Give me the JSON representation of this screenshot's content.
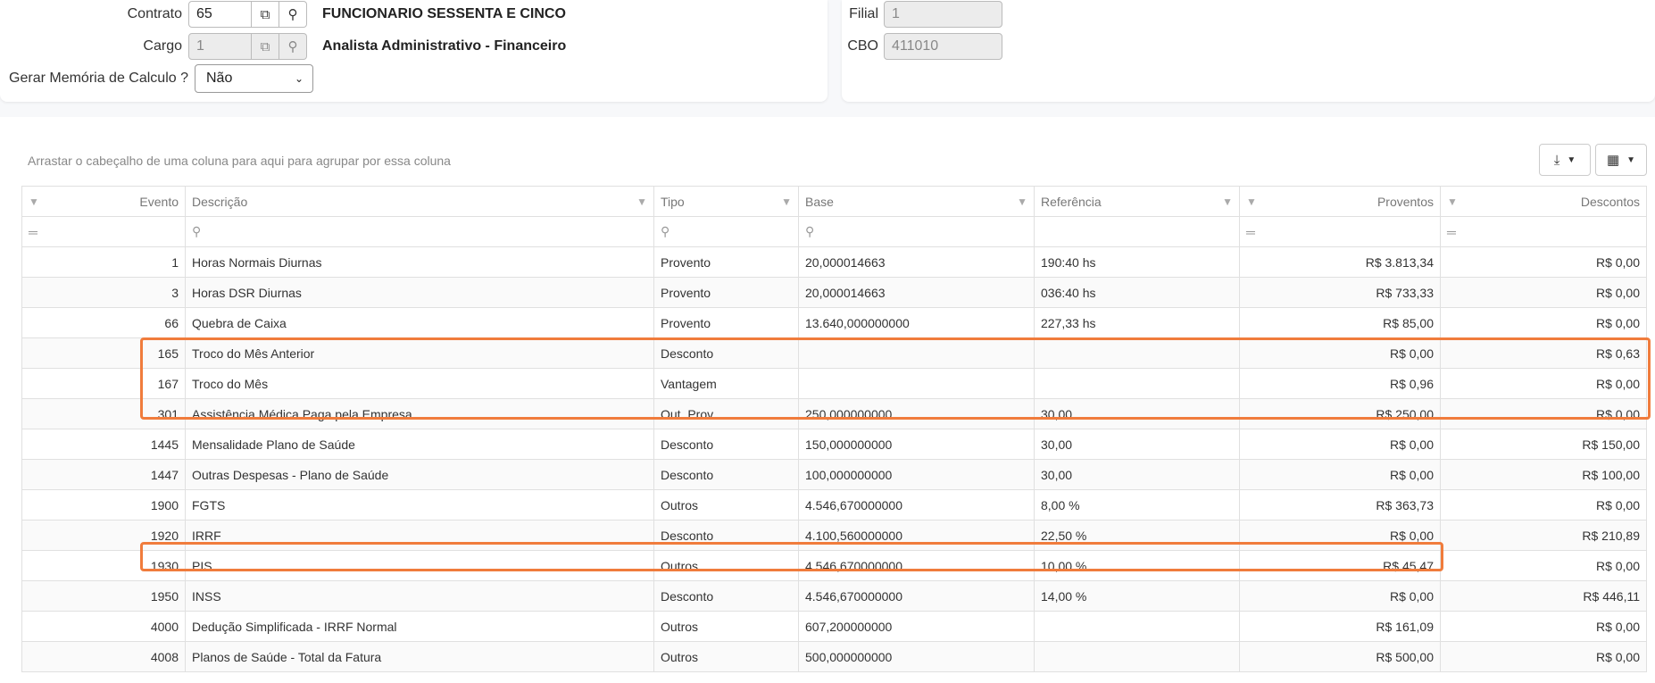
{
  "form": {
    "contrato_label": "Contrato",
    "contrato_value": "65",
    "contrato_name": "FUNCIONARIO SESSENTA E CINCO",
    "cargo_label": "Cargo",
    "cargo_value": "1",
    "cargo_name": "Analista Administrativo - Financeiro",
    "memoria_label": "Gerar Memória de Calculo ?",
    "memoria_value": "Não",
    "filial_label": "Filial",
    "filial_value": "1",
    "cbo_label": "CBO",
    "cbo_value": "411010"
  },
  "grid": {
    "group_hint": "Arrastar o cabeçalho de uma coluna para aqui para agrupar por essa coluna",
    "columns": {
      "evento": "Evento",
      "descricao": "Descrição",
      "tipo": "Tipo",
      "base": "Base",
      "referencia": "Referência",
      "proventos": "Proventos",
      "descontos": "Descontos"
    },
    "rows": [
      {
        "evento": "1",
        "descricao": "Horas Normais Diurnas",
        "tipo": "Provento",
        "base": "20,000014663",
        "referencia": "190:40 hs",
        "proventos": "R$ 3.813,34",
        "descontos": "R$ 0,00"
      },
      {
        "evento": "3",
        "descricao": "Horas DSR Diurnas",
        "tipo": "Provento",
        "base": "20,000014663",
        "referencia": "036:40 hs",
        "proventos": "R$ 733,33",
        "descontos": "R$ 0,00"
      },
      {
        "evento": "66",
        "descricao": "Quebra de Caixa",
        "tipo": "Provento",
        "base": "13.640,000000000",
        "referencia": "227,33 hs",
        "proventos": "R$ 85,00",
        "descontos": "R$ 0,00"
      },
      {
        "evento": "165",
        "descricao": "Troco do Mês Anterior",
        "tipo": "Desconto",
        "base": "",
        "referencia": "",
        "proventos": "R$ 0,00",
        "descontos": "R$ 0,63"
      },
      {
        "evento": "167",
        "descricao": "Troco do Mês",
        "tipo": "Vantagem",
        "base": "",
        "referencia": "",
        "proventos": "R$ 0,96",
        "descontos": "R$ 0,00"
      },
      {
        "evento": "301",
        "descricao": "Assistência Médica Paga pela Empresa",
        "tipo": "Out. Prov.",
        "base": "250,000000000",
        "referencia": "30,00",
        "proventos": "R$ 250,00",
        "descontos": "R$ 0,00"
      },
      {
        "evento": "1445",
        "descricao": "Mensalidade  Plano de Saúde",
        "tipo": "Desconto",
        "base": "150,000000000",
        "referencia": "30,00",
        "proventos": "R$ 0,00",
        "descontos": "R$ 150,00"
      },
      {
        "evento": "1447",
        "descricao": "Outras Despesas - Plano de Saúde",
        "tipo": "Desconto",
        "base": "100,000000000",
        "referencia": "30,00",
        "proventos": "R$ 0,00",
        "descontos": "R$ 100,00"
      },
      {
        "evento": "1900",
        "descricao": "FGTS",
        "tipo": "Outros",
        "base": "4.546,670000000",
        "referencia": "8,00 %",
        "proventos": "R$ 363,73",
        "descontos": "R$ 0,00"
      },
      {
        "evento": "1920",
        "descricao": "IRRF",
        "tipo": "Desconto",
        "base": "4.100,560000000",
        "referencia": "22,50 %",
        "proventos": "R$ 0,00",
        "descontos": "R$ 210,89"
      },
      {
        "evento": "1930",
        "descricao": "PIS",
        "tipo": "Outros",
        "base": "4.546,670000000",
        "referencia": "10,00 %",
        "proventos": "R$ 45,47",
        "descontos": "R$ 0,00"
      },
      {
        "evento": "1950",
        "descricao": "INSS",
        "tipo": "Desconto",
        "base": "4.546,670000000",
        "referencia": "14,00 %",
        "proventos": "R$ 0,00",
        "descontos": "R$ 446,11"
      },
      {
        "evento": "4000",
        "descricao": "Dedução Simplificada - IRRF Normal",
        "tipo": "Outros",
        "base": "607,200000000",
        "referencia": "",
        "proventos": "R$ 161,09",
        "descontos": "R$ 0,00"
      },
      {
        "evento": "4008",
        "descricao": "Planos de Saúde - Total da Fatura",
        "tipo": "Outros",
        "base": "500,000000000",
        "referencia": "",
        "proventos": "R$ 500,00",
        "descontos": "R$ 0,00"
      }
    ]
  },
  "colors": {
    "highlight": "#f07c3c"
  }
}
